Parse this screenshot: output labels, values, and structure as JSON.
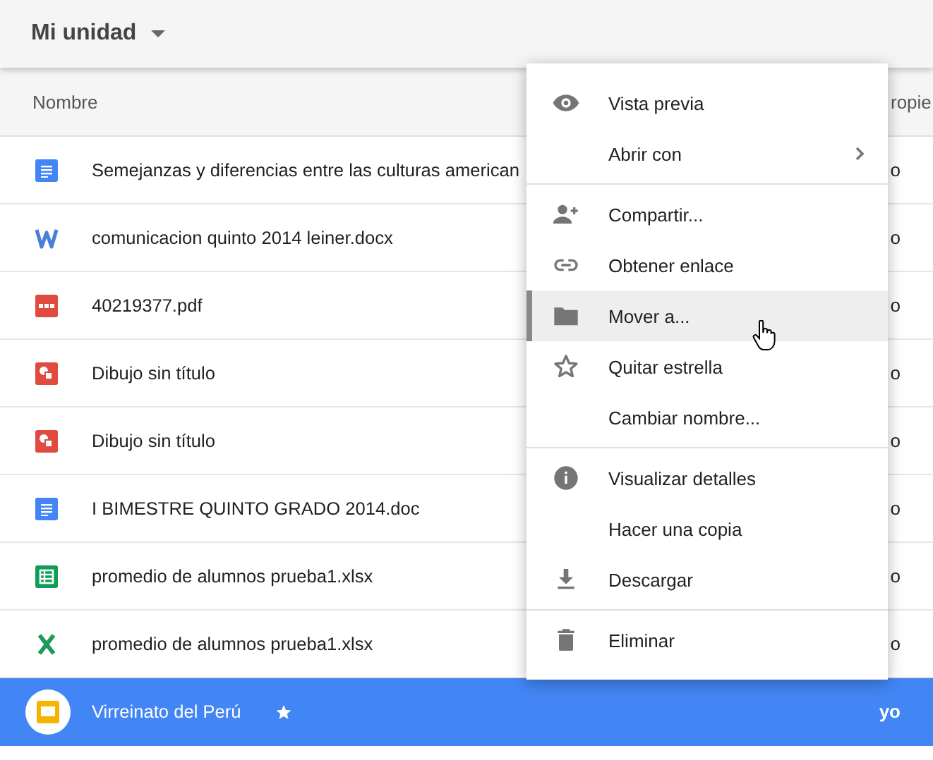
{
  "header": {
    "title": "Mi unidad"
  },
  "table": {
    "columns": [
      "Nombre",
      "ropie"
    ],
    "rows": [
      {
        "kind": "doc",
        "name": "Semejanzas y diferencias entre las culturas american",
        "owner": "o",
        "selected": false,
        "starred": false
      },
      {
        "kind": "word",
        "name": "comunicacion quinto 2014 leiner.docx",
        "owner": "o",
        "selected": false,
        "starred": false
      },
      {
        "kind": "pdf",
        "name": "40219377.pdf",
        "owner": "o",
        "selected": false,
        "starred": false
      },
      {
        "kind": "drawing",
        "name": "Dibujo sin título",
        "owner": "o",
        "selected": false,
        "starred": false
      },
      {
        "kind": "drawing",
        "name": "Dibujo sin título",
        "owner": "o",
        "selected": false,
        "starred": false
      },
      {
        "kind": "doc",
        "name": "I BIMESTRE QUINTO GRADO 2014.doc",
        "owner": "o",
        "selected": false,
        "starred": false
      },
      {
        "kind": "sheet",
        "name": "promedio de alumnos prueba1.xlsx",
        "owner": "o",
        "selected": false,
        "starred": false
      },
      {
        "kind": "excel",
        "name": "promedio de alumnos prueba1.xlsx",
        "owner": "o",
        "selected": false,
        "starred": false
      },
      {
        "kind": "slides",
        "name": "Virreinato del Perú",
        "owner": "yo",
        "selected": true,
        "starred": true
      }
    ]
  },
  "context_menu": {
    "groups": [
      [
        {
          "kind": "eye",
          "label": "Vista previa",
          "hovered": false,
          "submenu": false
        },
        {
          "kind": "plain",
          "label": "Abrir con",
          "hovered": false,
          "submenu": true
        }
      ],
      [
        {
          "kind": "person-add",
          "label": "Compartir...",
          "hovered": false,
          "submenu": false
        },
        {
          "kind": "link",
          "label": "Obtener enlace",
          "hovered": false,
          "submenu": false
        },
        {
          "kind": "folder",
          "label": "Mover a...",
          "hovered": true,
          "submenu": false
        },
        {
          "kind": "star",
          "label": "Quitar estrella",
          "hovered": false,
          "submenu": false
        },
        {
          "kind": "plain",
          "label": "Cambiar nombre...",
          "hovered": false,
          "submenu": false
        }
      ],
      [
        {
          "kind": "info",
          "label": "Visualizar detalles",
          "hovered": false,
          "submenu": false
        },
        {
          "kind": "plain",
          "label": "Hacer una copia",
          "hovered": false,
          "submenu": false
        },
        {
          "kind": "download",
          "label": "Descargar",
          "hovered": false,
          "submenu": false
        }
      ],
      [
        {
          "kind": "trash",
          "label": "Eliminar",
          "hovered": false,
          "submenu": false
        }
      ]
    ]
  }
}
